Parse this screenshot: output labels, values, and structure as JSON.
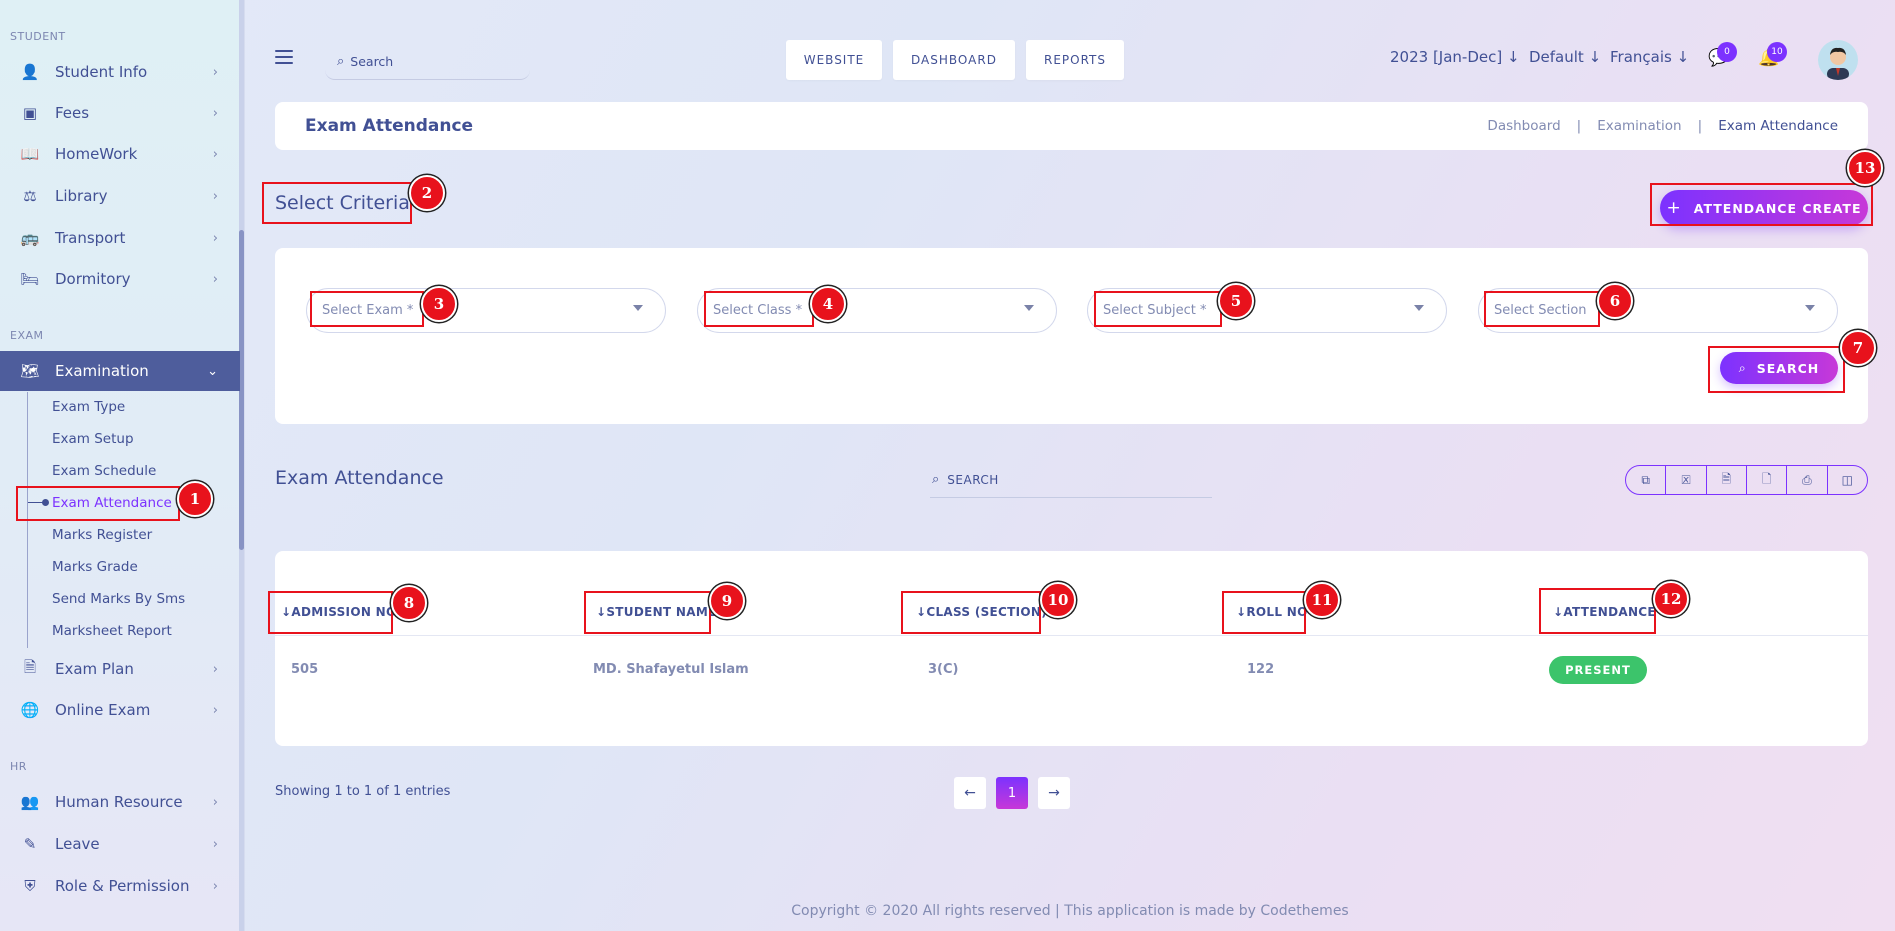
{
  "sidebar": {
    "sections": {
      "student": "STUDENT",
      "exam": "EXAM",
      "hr": "HR"
    },
    "items": {
      "student_info": "Student Info",
      "fees": "Fees",
      "homework": "HomeWork",
      "library": "Library",
      "transport": "Transport",
      "dormitory": "Dormitory",
      "examination": "Examination",
      "exam_plan": "Exam Plan",
      "online_exam": "Online Exam",
      "human_resource": "Human Resource",
      "leave": "Leave",
      "role_permission": "Role & Permission"
    },
    "examination_sub": {
      "exam_type": "Exam Type",
      "exam_setup": "Exam Setup",
      "exam_schedule": "Exam Schedule",
      "exam_attendance": "Exam Attendance",
      "marks_register": "Marks Register",
      "marks_grade": "Marks Grade",
      "send_marks_by_sms": "Send Marks By Sms",
      "marksheet_report": "Marksheet Report"
    }
  },
  "header": {
    "search_placeholder": "Search",
    "buttons": {
      "website": "WEBSITE",
      "dashboard": "DASHBOARD",
      "reports": "REPORTS"
    },
    "session": "2023 [Jan-Dec] ↓",
    "style": "Default ↓",
    "language": "Français ↓",
    "messages_count": "0",
    "notifications_count": "10"
  },
  "titlebar": {
    "title": "Exam Attendance",
    "breadcrumb": {
      "b1": "Dashboard",
      "sep": "|",
      "b2": "Examination",
      "b3": "Exam Attendance"
    }
  },
  "criteria": {
    "heading": "Select Criteria",
    "create_button": "ATTENDANCE CREATE",
    "select_exam": "Select Exam *",
    "select_class": "Select Class *",
    "select_subject": "Select Subject *",
    "select_section": "Select Section",
    "search_button": "SEARCH"
  },
  "list": {
    "heading": "Exam Attendance",
    "search_placeholder": "SEARCH",
    "columns": {
      "admission_no": "↓ADMISSION NO",
      "student_name": "↓STUDENT NAME",
      "class_section": "↓CLASS (SECTION)",
      "roll_no": "↓ROLL NO",
      "attendance": "↓ATTENDANCE"
    },
    "rows": [
      {
        "admission_no": "505",
        "student_name": "MD. Shafayetul Islam",
        "class_section": "3(C)",
        "roll_no": "122",
        "attendance": "PRESENT"
      }
    ],
    "showing": "Showing 1 to 1 of 1 entries",
    "pagination": {
      "prev": "←",
      "current": "1",
      "next": "→"
    }
  },
  "footer": "Copyright © 2020 All rights reserved | This application is made by Codethemes",
  "annotations": [
    "1",
    "2",
    "3",
    "4",
    "5",
    "6",
    "7",
    "8",
    "9",
    "10",
    "11",
    "12",
    "13"
  ],
  "colors": {
    "accent": "#7c32ff",
    "sidebar_active": "#4e5d9c",
    "present": "#3cc46b",
    "annotation": "#e8121c"
  }
}
